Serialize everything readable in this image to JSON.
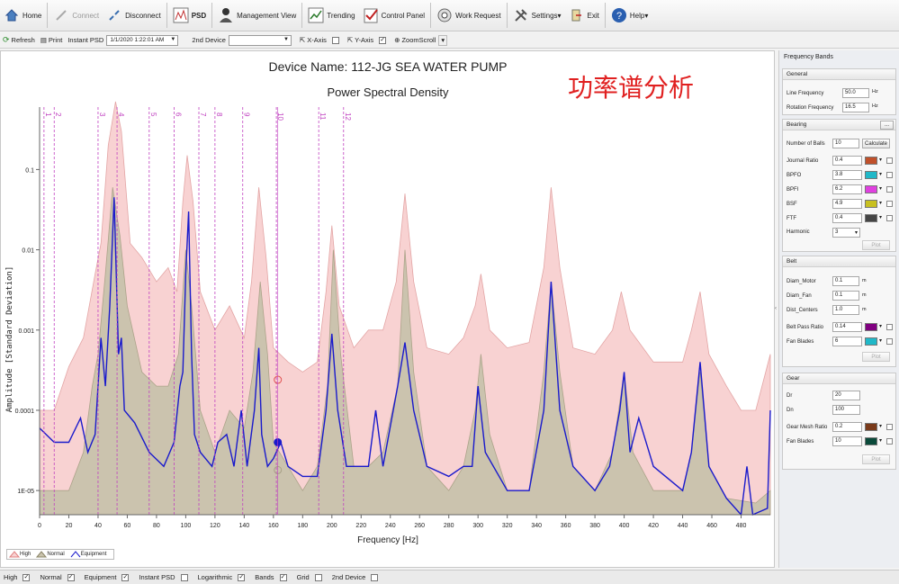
{
  "toolbar": {
    "items": [
      {
        "label": "Home",
        "icon": "home-icon"
      },
      {
        "label": "Connect",
        "icon": "connect-icon",
        "disabled": true
      },
      {
        "label": "Disconnect",
        "icon": "disconnect-icon"
      },
      {
        "label": "PSD",
        "icon": "psd-icon"
      },
      {
        "label": "Management View",
        "icon": "user-icon"
      },
      {
        "label": "Trending",
        "icon": "trending-icon"
      },
      {
        "label": "Control Panel",
        "icon": "control-panel-icon"
      },
      {
        "label": "Work Request",
        "icon": "work-request-icon"
      },
      {
        "label": "Settings",
        "icon": "settings-icon"
      },
      {
        "label": "Exit",
        "icon": "exit-icon"
      },
      {
        "label": "Help",
        "icon": "help-icon"
      }
    ]
  },
  "toolbar2": {
    "refresh": "Refresh",
    "print": "Print",
    "instant_psd_label": "Instant PSD",
    "instant_psd_value": "1/1/2020 1:22:01 AM",
    "second_device_label": "2nd Device",
    "second_device_value": "",
    "x_axis": "X-Axis",
    "y_axis": "Y-Axis",
    "zoomscroll": "ZoomScroll"
  },
  "chart": {
    "title": "Device Name: 112-JG SEA WATER PUMP",
    "subtitle": "Power Spectral Density",
    "annotation": "功率谱分析",
    "xlabel": "Frequency [Hz]",
    "ylabel": "Amplitude [Standard Deviation]",
    "legend": [
      "High",
      "Normal",
      "Equipment"
    ]
  },
  "chart_data": {
    "type": "area",
    "x_range": [
      0,
      500
    ],
    "y_scale": "log",
    "y_range": [
      5e-06,
      0.6
    ],
    "x_ticks": [
      0,
      20,
      40,
      60,
      80,
      100,
      120,
      140,
      160,
      180,
      200,
      220,
      240,
      260,
      280,
      300,
      320,
      340,
      360,
      380,
      400,
      420,
      440,
      460,
      480
    ],
    "y_ticks": [
      {
        "v": 0.1,
        "label": "0.1"
      },
      {
        "v": 0.01,
        "label": "0.01"
      },
      {
        "v": 0.001,
        "label": "0.001"
      },
      {
        "v": 0.0001,
        "label": "0.0001"
      },
      {
        "v": 1e-05,
        "label": "1E-05"
      }
    ],
    "bands": [
      {
        "label": "1",
        "x": 3
      },
      {
        "label": "2",
        "x": 10
      },
      {
        "label": "3",
        "x": 40
      },
      {
        "label": "4",
        "x": 53
      },
      {
        "label": "5",
        "x": 75
      },
      {
        "label": "6",
        "x": 92
      },
      {
        "label": "7",
        "x": 109
      },
      {
        "label": "8",
        "x": 120
      },
      {
        "label": "9",
        "x": 139
      },
      {
        "label": "10",
        "x": 162
      },
      {
        "label": "11",
        "x": 191
      },
      {
        "label": "12",
        "x": 208
      }
    ],
    "series": [
      {
        "name": "High",
        "color": "#f8d2d2",
        "stroke": "#e3a5a5",
        "points": [
          [
            0,
            0.0001
          ],
          [
            10,
            0.0001
          ],
          [
            20,
            0.00035
          ],
          [
            30,
            0.0008
          ],
          [
            38,
            0.005
          ],
          [
            42,
            0.012
          ],
          [
            47,
            0.2
          ],
          [
            52,
            0.7
          ],
          [
            56,
            0.3
          ],
          [
            62,
            0.012
          ],
          [
            70,
            0.008
          ],
          [
            80,
            0.004
          ],
          [
            88,
            0.006
          ],
          [
            94,
            0.003
          ],
          [
            98,
            0.04
          ],
          [
            101,
            0.15
          ],
          [
            105,
            0.04
          ],
          [
            110,
            0.003
          ],
          [
            120,
            0.001
          ],
          [
            130,
            0.002
          ],
          [
            140,
            0.0008
          ],
          [
            145,
            0.004
          ],
          [
            150,
            0.06
          ],
          [
            155,
            0.008
          ],
          [
            160,
            0.0006
          ],
          [
            170,
            0.0004
          ],
          [
            180,
            0.0003
          ],
          [
            190,
            0.0004
          ],
          [
            196,
            0.003
          ],
          [
            200,
            0.02
          ],
          [
            205,
            0.002
          ],
          [
            215,
            0.0006
          ],
          [
            225,
            0.001
          ],
          [
            235,
            0.001
          ],
          [
            244,
            0.004
          ],
          [
            250,
            0.05
          ],
          [
            256,
            0.004
          ],
          [
            265,
            0.0006
          ],
          [
            280,
            0.0005
          ],
          [
            290,
            0.0008
          ],
          [
            298,
            0.002
          ],
          [
            302,
            0.005
          ],
          [
            308,
            0.001
          ],
          [
            320,
            0.0006
          ],
          [
            335,
            0.0007
          ],
          [
            345,
            0.006
          ],
          [
            350,
            0.06
          ],
          [
            356,
            0.006
          ],
          [
            365,
            0.0006
          ],
          [
            380,
            0.0005
          ],
          [
            392,
            0.001
          ],
          [
            398,
            0.003
          ],
          [
            404,
            0.001
          ],
          [
            420,
            0.0004
          ],
          [
            440,
            0.0004
          ],
          [
            446,
            0.001
          ],
          [
            452,
            0.003
          ],
          [
            458,
            0.0005
          ],
          [
            470,
            0.0002
          ],
          [
            480,
            0.0001
          ],
          [
            490,
            0.0001
          ],
          [
            500,
            0.0005
          ]
        ]
      },
      {
        "name": "Normal",
        "color": "#c9c3ad",
        "stroke": "#a8a186",
        "points": [
          [
            0,
            1e-05
          ],
          [
            10,
            1e-05
          ],
          [
            20,
            1e-05
          ],
          [
            30,
            3e-05
          ],
          [
            36,
            0.0002
          ],
          [
            40,
            0.0005
          ],
          [
            45,
            0.005
          ],
          [
            50,
            0.06
          ],
          [
            55,
            0.015
          ],
          [
            60,
            0.002
          ],
          [
            70,
            0.0003
          ],
          [
            80,
            0.0002
          ],
          [
            88,
            0.0002
          ],
          [
            95,
            0.0005
          ],
          [
            100,
            0.01
          ],
          [
            104,
            0.002
          ],
          [
            110,
            0.0001
          ],
          [
            120,
            3e-05
          ],
          [
            130,
            0.0001
          ],
          [
            140,
            6e-05
          ],
          [
            146,
            0.0003
          ],
          [
            151,
            0.004
          ],
          [
            156,
            0.0005
          ],
          [
            160,
            4e-05
          ],
          [
            170,
            2e-05
          ],
          [
            180,
            1e-05
          ],
          [
            190,
            2e-05
          ],
          [
            197,
            0.0002
          ],
          [
            201,
            0.01
          ],
          [
            206,
            0.0005
          ],
          [
            215,
            2e-05
          ],
          [
            225,
            2e-05
          ],
          [
            235,
            3e-05
          ],
          [
            245,
            0.0002
          ],
          [
            250,
            0.01
          ],
          [
            256,
            0.0003
          ],
          [
            265,
            2e-05
          ],
          [
            280,
            1e-05
          ],
          [
            290,
            2e-05
          ],
          [
            298,
            0.0001
          ],
          [
            302,
            0.0005
          ],
          [
            308,
            5e-05
          ],
          [
            320,
            1e-05
          ],
          [
            335,
            1e-05
          ],
          [
            345,
            0.0003
          ],
          [
            350,
            0.004
          ],
          [
            356,
            0.0003
          ],
          [
            365,
            2e-05
          ],
          [
            380,
            1e-05
          ],
          [
            392,
            3e-05
          ],
          [
            400,
            0.0003
          ],
          [
            406,
            3e-05
          ],
          [
            420,
            1e-05
          ],
          [
            440,
            1e-05
          ],
          [
            446,
            3e-05
          ],
          [
            452,
            0.0003
          ],
          [
            458,
            2e-05
          ],
          [
            470,
            8e-06
          ],
          [
            490,
            7e-06
          ],
          [
            500,
            1e-05
          ]
        ]
      },
      {
        "name": "Equipment",
        "color": "#1a1acc",
        "points": [
          [
            0,
            6e-05
          ],
          [
            10,
            4e-05
          ],
          [
            20,
            4e-05
          ],
          [
            28,
            8e-05
          ],
          [
            33,
            3e-05
          ],
          [
            38,
            5e-05
          ],
          [
            42,
            0.0008
          ],
          [
            45,
            0.0002
          ],
          [
            48,
            0.002
          ],
          [
            51,
            0.045
          ],
          [
            54,
            0.0005
          ],
          [
            56,
            0.0008
          ],
          [
            58,
            0.0001
          ],
          [
            65,
            7e-05
          ],
          [
            75,
            3e-05
          ],
          [
            85,
            2e-05
          ],
          [
            92,
            4e-05
          ],
          [
            96,
            0.0002
          ],
          [
            98,
            0.0003
          ],
          [
            100,
            0.005
          ],
          [
            102,
            0.03
          ],
          [
            104,
            0.0005
          ],
          [
            106,
            5e-05
          ],
          [
            110,
            3e-05
          ],
          [
            118,
            2e-05
          ],
          [
            122,
            4e-05
          ],
          [
            128,
            5e-05
          ],
          [
            133,
            2e-05
          ],
          [
            138,
            0.0001
          ],
          [
            142,
            2e-05
          ],
          [
            147,
            0.0001
          ],
          [
            150,
            0.0006
          ],
          [
            152,
            5e-05
          ],
          [
            156,
            2e-05
          ],
          [
            160,
            2.5e-05
          ],
          [
            165,
            4e-05
          ],
          [
            170,
            2e-05
          ],
          [
            180,
            1.5e-05
          ],
          [
            190,
            1.5e-05
          ],
          [
            196,
            0.0001
          ],
          [
            200,
            0.0009
          ],
          [
            204,
            0.0001
          ],
          [
            210,
            2e-05
          ],
          [
            225,
            2e-05
          ],
          [
            230,
            0.0001
          ],
          [
            235,
            2e-05
          ],
          [
            245,
            0.0002
          ],
          [
            250,
            0.0007
          ],
          [
            256,
            0.0001
          ],
          [
            265,
            2e-05
          ],
          [
            280,
            1.5e-05
          ],
          [
            290,
            2e-05
          ],
          [
            296,
            2e-05
          ],
          [
            300,
            0.0002
          ],
          [
            305,
            3e-05
          ],
          [
            320,
            1e-05
          ],
          [
            335,
            1e-05
          ],
          [
            345,
            0.0001
          ],
          [
            350,
            0.004
          ],
          [
            356,
            0.0001
          ],
          [
            365,
            2e-05
          ],
          [
            380,
            1e-05
          ],
          [
            390,
            2e-05
          ],
          [
            397,
            0.0001
          ],
          [
            400,
            0.0003
          ],
          [
            404,
            3e-05
          ],
          [
            410,
            8e-05
          ],
          [
            420,
            2e-05
          ],
          [
            440,
            1e-05
          ],
          [
            446,
            3e-05
          ],
          [
            452,
            0.0004
          ],
          [
            458,
            2e-05
          ],
          [
            470,
            8e-06
          ],
          [
            480,
            5e-06
          ],
          [
            484,
            2e-05
          ],
          [
            488,
            5e-06
          ],
          [
            498,
            6e-06
          ],
          [
            500,
            0.0001
          ]
        ]
      }
    ],
    "markers": [
      {
        "x": 163,
        "y": 4e-05,
        "color": "#1a1acc",
        "filled": true
      },
      {
        "x": 163,
        "y": 0.00024,
        "color": "#e05050",
        "filled": false
      },
      {
        "x": 163,
        "y": 1.8e-05,
        "color": "#a8a186",
        "filled": false
      }
    ]
  },
  "panel": {
    "title": "Frequency Bands",
    "general": {
      "title": "General",
      "line_frequency_label": "Line Frequency",
      "line_frequency": "50.0",
      "line_frequency_unit": "Hz",
      "rotation_frequency_label": "Rotation Frequency",
      "rotation_frequency": "16.5",
      "rotation_frequency_unit": "Hz"
    },
    "bearing": {
      "title": "Bearing",
      "more": "...",
      "balls_label": "Number of Balls",
      "balls": "10",
      "calculate": "Calculate",
      "ratios": [
        {
          "label": "Journal Ratio",
          "value": "0.4",
          "color": "#c0502a"
        },
        {
          "label": "BPFO",
          "value": "3.8",
          "color": "#20b8c8"
        },
        {
          "label": "BPFI",
          "value": "6.2",
          "color": "#e040e0"
        },
        {
          "label": "BSF",
          "value": "4.9",
          "color": "#c8c020"
        },
        {
          "label": "FTF",
          "value": "0.4",
          "color": "#454545"
        }
      ],
      "harmonic_label": "Harmonic",
      "harmonic": "3",
      "plot": "Plot"
    },
    "belt": {
      "title": "Belt",
      "diam_motor_label": "Diam_Motor",
      "diam_motor": "0.1",
      "diam_motor_unit": "m",
      "diam_fan_label": "Diam_Fan",
      "diam_fan": "0.1",
      "diam_fan_unit": "m",
      "dist_label": "Dist_Centers",
      "dist": "1.0",
      "dist_unit": "m",
      "pass_ratio_label": "Belt Pass Ratio",
      "pass_ratio": "0.14",
      "pass_ratio_color": "#800080",
      "fan_blades_label": "Fan Blades",
      "fan_blades": "6",
      "fan_blades_color": "#20b8c8",
      "plot": "Plot"
    },
    "gear": {
      "title": "Gear",
      "dr_label": "Dr",
      "dr": "20",
      "dn_label": "Dn",
      "dn": "100",
      "mesh_label": "Gear Mesh Ratio",
      "mesh": "0.2",
      "mesh_color": "#7a3a1a",
      "fan_blades_label": "Fan Blades",
      "fan_blades": "10",
      "fan_blades_color": "#0a4a3a",
      "plot": "Plot"
    }
  },
  "bottom": {
    "items": [
      {
        "label": "High",
        "checked": true
      },
      {
        "label": "Normal",
        "checked": true
      },
      {
        "label": "Equipment",
        "checked": true
      },
      {
        "label": "Instant PSD",
        "checked": false
      },
      {
        "label": "Logarithmic",
        "checked": true
      },
      {
        "label": "Bands",
        "checked": true
      },
      {
        "label": "Grid",
        "checked": false
      },
      {
        "label": "2nd Device",
        "checked": false
      }
    ]
  }
}
